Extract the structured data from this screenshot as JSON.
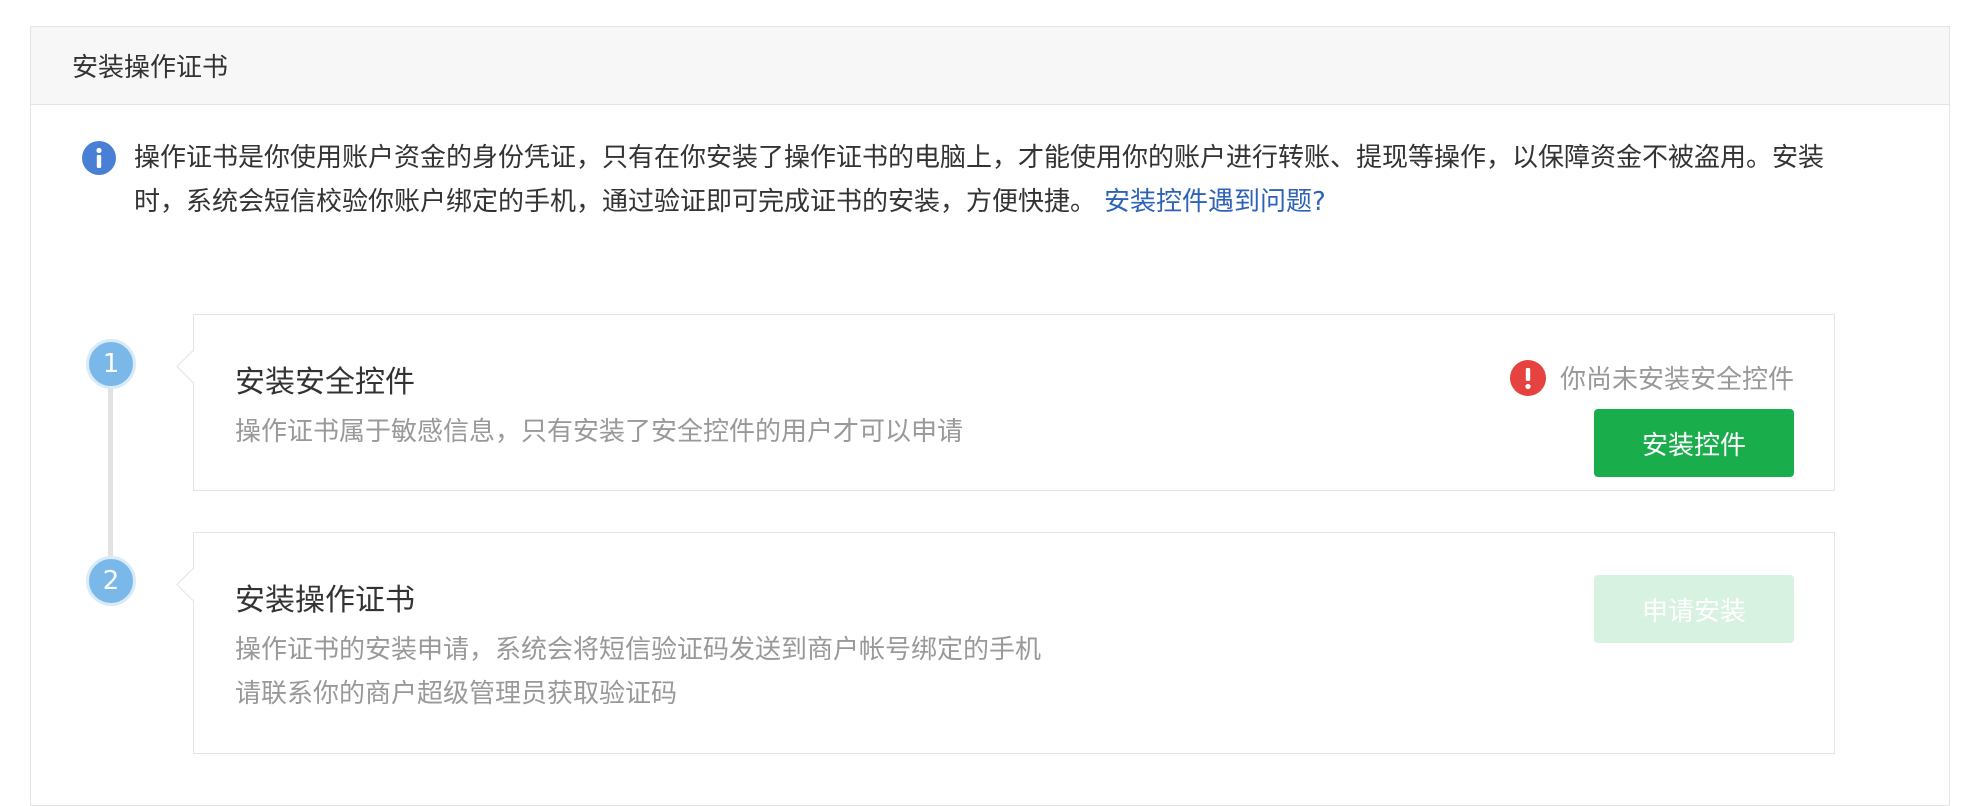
{
  "panel": {
    "title": "安装操作证书"
  },
  "notice": {
    "text": "操作证书是你使用账户资金的身份凭证，只有在你安装了操作证书的电脑上，才能使用你的账户进行转账、提现等操作，以保障资金不被盗用。安装时，系统会短信校验你账户绑定的手机，通过验证即可完成证书的安装，方便快捷。",
    "link": "安装控件遇到问题?",
    "icon": "info-icon"
  },
  "steps": [
    {
      "number": "1",
      "title": "安装安全控件",
      "desc": "操作证书属于敏感信息，只有安装了安全控件的用户才可以申请",
      "status": "你尚未安装安全控件",
      "status_icon": "warning-icon",
      "button": "安装控件",
      "button_enabled": true
    },
    {
      "number": "2",
      "title": "安装操作证书",
      "desc_line1": "操作证书的安装申请，系统会将短信验证码发送到商户帐号绑定的手机",
      "desc_line2": "请联系你的商户超级管理员获取验证码",
      "button": "申请安装",
      "button_enabled": false
    }
  ],
  "colors": {
    "primary_button": "#1aad4c",
    "disabled_button": "#d7f2e0",
    "link": "#2e62b8",
    "step_dot": "#7ab8ea",
    "warning": "#e64340",
    "info": "#4a7fd6"
  }
}
